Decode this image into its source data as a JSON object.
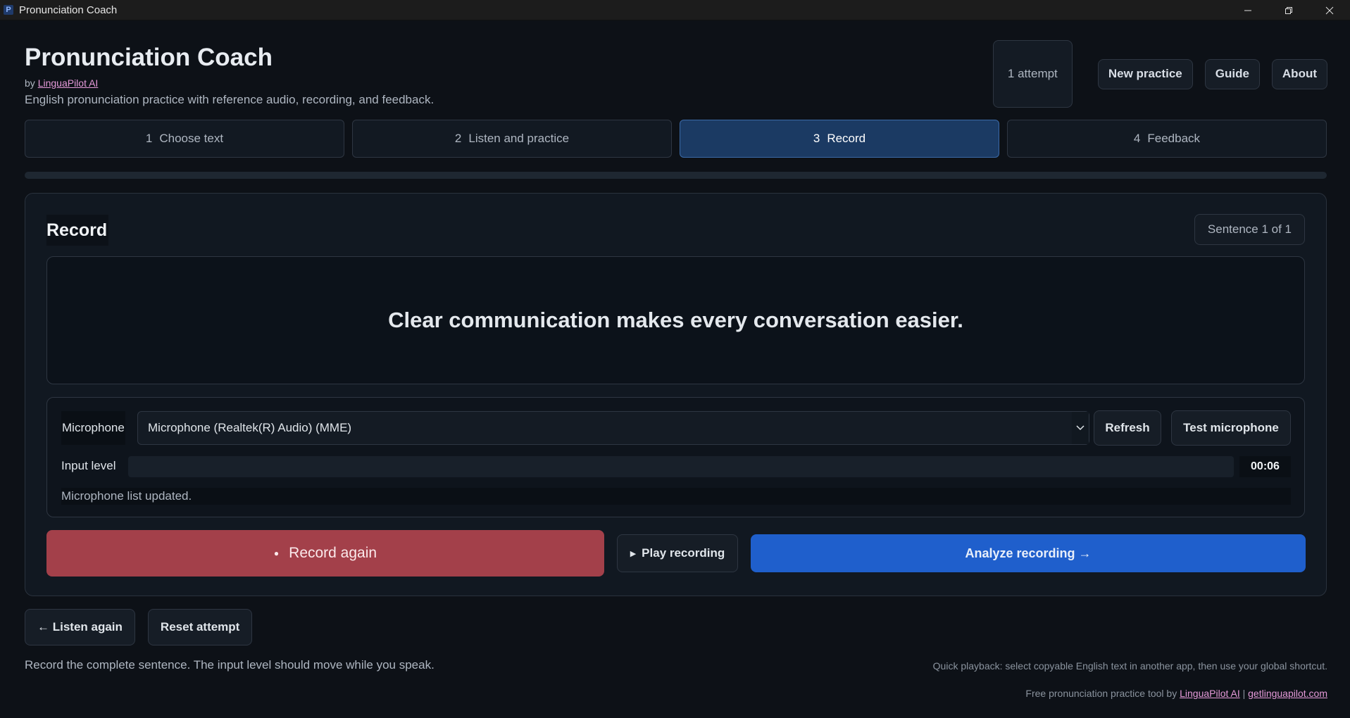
{
  "window": {
    "app_icon_letter": "P",
    "title": "Pronunciation Coach"
  },
  "header": {
    "title": "Pronunciation Coach",
    "by_prefix": "by",
    "by_link": "LinguaPilot AI",
    "subtitle": "English pronunciation practice with reference audio, recording, and feedback.",
    "attempts": "1 attempt",
    "buttons": [
      "New practice",
      "Guide",
      "About"
    ]
  },
  "steps": [
    {
      "num": "1",
      "label": "Choose text"
    },
    {
      "num": "2",
      "label": "Listen and practice"
    },
    {
      "num": "3",
      "label": "Record"
    },
    {
      "num": "4",
      "label": "Feedback"
    }
  ],
  "active_step": 3,
  "record_panel": {
    "title": "Record",
    "sentence_badge": "Sentence 1 of 1",
    "sentence": "Clear communication makes every conversation easier.",
    "microphone_label": "Microphone",
    "microphone_selected": "Microphone (Realtek(R) Audio) (MME)",
    "refresh_label": "Refresh",
    "test_label": "Test microphone",
    "input_level_label": "Input level",
    "input_level": 0,
    "timer": "00:06",
    "status": "Microphone list updated.",
    "record_label": "Record again",
    "play_label": "Play recording",
    "analyze_label": "Analyze recording →"
  },
  "bottom": {
    "listen_again": "← Listen again",
    "reset": "Reset attempt",
    "hint": "Record the complete sentence. The input level should move while you speak.",
    "quick_playback": "Quick playback: select copyable English text in another app, then use your global shortcut.",
    "footer_prefix": "Free pronunciation practice tool by",
    "footer_link1": "LinguaPilot AI",
    "footer_sep": "|",
    "footer_link2": "getlinguapilot.com"
  },
  "colors": {
    "background": "#0d1117",
    "active_step": "#1b3a63",
    "record": "#a3404a",
    "analyze": "#1f5fcc",
    "link": "#e59ad9"
  }
}
